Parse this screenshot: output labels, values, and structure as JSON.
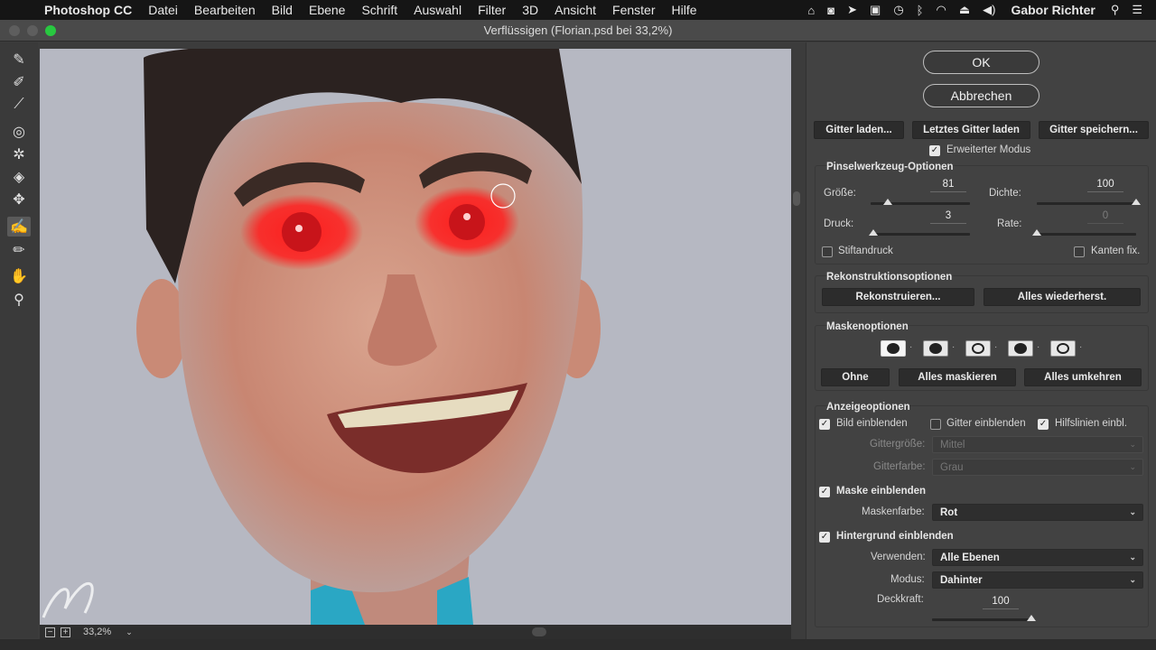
{
  "menubar": {
    "apple": "",
    "app_name": "Photoshop CC",
    "items": [
      "Datei",
      "Bearbeiten",
      "Bild",
      "Ebene",
      "Schrift",
      "Auswahl",
      "Filter",
      "3D",
      "Ansicht",
      "Fenster",
      "Hilfe"
    ],
    "user": "Gabor Richter"
  },
  "window": {
    "title": "Verflüssigen (Florian.psd bei 33,2%)"
  },
  "statusbar": {
    "zoom": "33,2%"
  },
  "panel": {
    "ok": "OK",
    "cancel": "Abbrechen",
    "load_mesh": "Gitter laden...",
    "load_last_mesh": "Letztes Gitter laden",
    "save_mesh": "Gitter speichern...",
    "advanced_mode": "Erweiterter Modus",
    "advanced_mode_checked": true,
    "brush": {
      "title": "Pinselwerkzeug-Optionen",
      "size_label": "Größe:",
      "size_value": "81",
      "size_level": 0.17,
      "density_label": "Dichte:",
      "density_value": "100",
      "density_level": 1.0,
      "pressure_label": "Druck:",
      "pressure_value": "3",
      "pressure_level": 0.03,
      "rate_label": "Rate:",
      "rate_value": "0",
      "rate_level": 0.0,
      "stylus_label": "Stiftandruck",
      "stylus_checked": false,
      "pin_edges_label": "Kanten fix.",
      "pin_edges_checked": false
    },
    "reconstruct": {
      "title": "Rekonstruktionsoptionen",
      "reconstruct_btn": "Rekonstruieren...",
      "restore_all_btn": "Alles wiederherst."
    },
    "mask": {
      "title": "Maskenoptionen",
      "none_btn": "Ohne",
      "mask_all_btn": "Alles maskieren",
      "invert_all_btn": "Alles umkehren"
    },
    "view": {
      "title": "Anzeigeoptionen",
      "show_image": "Bild einblenden",
      "show_image_checked": true,
      "show_mesh": "Gitter einblenden",
      "show_mesh_checked": false,
      "show_guides": "Hilfslinien einbl.",
      "show_guides_checked": true,
      "mesh_size_label": "Gittergröße:",
      "mesh_size_value": "Mittel",
      "mesh_color_label": "Gitterfarbe:",
      "mesh_color_value": "Grau",
      "show_mask": "Maske einblenden",
      "show_mask_checked": true,
      "mask_color_label": "Maskenfarbe:",
      "mask_color_value": "Rot",
      "show_backdrop": "Hintergrund einblenden",
      "show_backdrop_checked": true,
      "use_label": "Verwenden:",
      "use_value": "Alle Ebenen",
      "mode_label": "Modus:",
      "mode_value": "Dahinter",
      "opacity_label": "Deckkraft:",
      "opacity_value": "100",
      "opacity_level": 1.0
    }
  },
  "colors": {
    "mask_red": "#ff2020",
    "shirt": "#2aa7c4",
    "backdrop": "#b6b8c2"
  }
}
